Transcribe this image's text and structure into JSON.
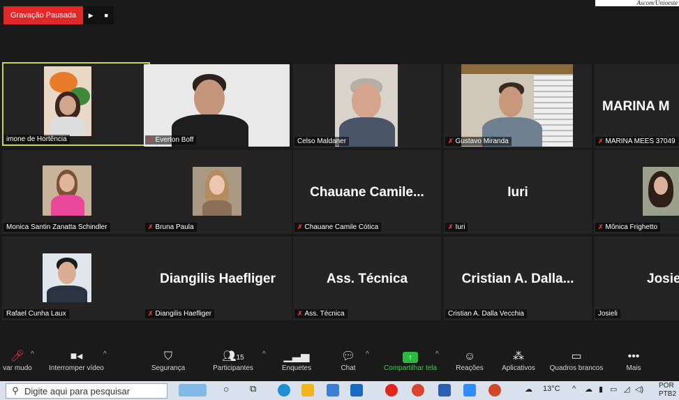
{
  "credit": "Ascom/Unioeste",
  "recording": {
    "label": "Gravação Pausada",
    "resume_icon": "play-icon",
    "stop_icon": "stop-icon"
  },
  "tiles": [
    {
      "name": "imone de Hortência",
      "big": "",
      "muted": false
    },
    {
      "name": "Everton Boff",
      "big": "",
      "muted": true
    },
    {
      "name": "Celso Maldaner",
      "big": "",
      "muted": false
    },
    {
      "name": "Gustavo Miranda",
      "big": "",
      "muted": true
    },
    {
      "name": "MARINA MEES 37049",
      "big": "MARINA M",
      "muted": true
    },
    {
      "name": "Monica Santin Zanatta Schindler",
      "big": "",
      "muted": false
    },
    {
      "name": "Bruna Paula",
      "big": "",
      "muted": true
    },
    {
      "name": "Chauane Camile Cótica",
      "big": "Chauane  Camile...",
      "muted": true
    },
    {
      "name": "Iuri",
      "big": "Iuri",
      "muted": true
    },
    {
      "name": "Mônica Frighetto",
      "big": "",
      "muted": true
    },
    {
      "name": "Rafael Cunha Laux",
      "big": "",
      "muted": false
    },
    {
      "name": "Diangilis Haefliger",
      "big": "Diangilis Haefliger",
      "muted": true
    },
    {
      "name": "Ass. Técnica",
      "big": "Ass. Técnica",
      "muted": true
    },
    {
      "name": "Cristian A. Dalla Vecchia",
      "big": "Cristian  A.  Dalla...",
      "muted": false
    },
    {
      "name": "Josieli",
      "big": "Josie",
      "muted": false
    }
  ],
  "toolbar": {
    "unmute": "var mudo",
    "video": "Interromper vídeo",
    "security": "Segurança",
    "participants": "Participantes",
    "participants_count": "15",
    "polls": "Enquetes",
    "chat": "Chat",
    "share": "Compartilhar tela",
    "reactions": "Reações",
    "apps": "Aplicativos",
    "whiteboards": "Quadros brancos",
    "more": "Mais"
  },
  "taskbar": {
    "search_placeholder": "Digite aqui para pesquisar",
    "temperature": "13°C",
    "lang1": "POR",
    "lang2": "PTB2"
  },
  "colors": {
    "recording": "#e02828",
    "active_speaker": "#c6d94b",
    "share": "#2aba3c"
  }
}
